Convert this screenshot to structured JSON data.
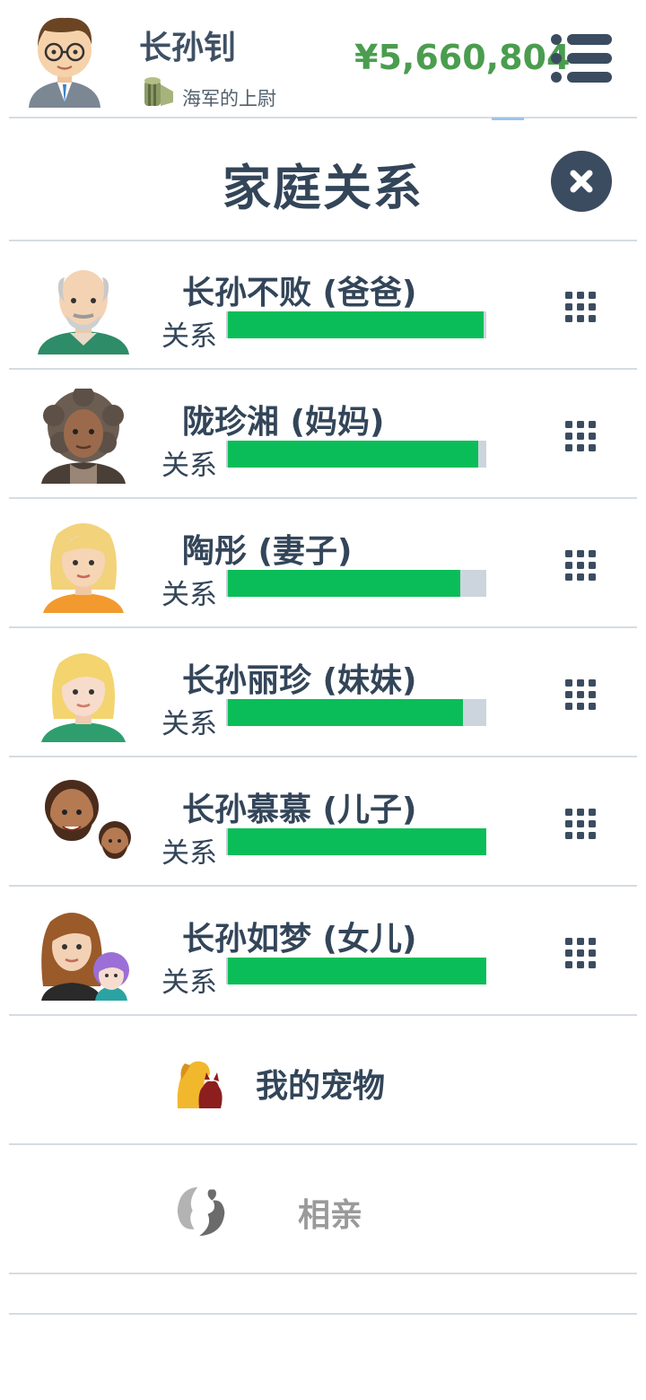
{
  "player": {
    "name": "长孙钊",
    "rank": "海军的上尉",
    "money": "¥5,660,804",
    "avatar_icon": "man-glasses-avatar",
    "rank_icon": "rank-insignia-icon"
  },
  "panel": {
    "title": "家庭关系",
    "close_icon": "close-icon"
  },
  "relationship_label": "关系",
  "family": [
    {
      "name": "长孙不败 (爸爸)",
      "relationship": 0.99,
      "avatar": "old-man-avatar"
    },
    {
      "name": "陇珍湘 (妈妈)",
      "relationship": 0.97,
      "avatar": "curly-hair-woman-avatar"
    },
    {
      "name": "陶彤 (妻子)",
      "relationship": 0.9,
      "avatar": "blonde-woman-avatar"
    },
    {
      "name": "长孙丽珍 (妹妹)",
      "relationship": 0.91,
      "avatar": "blonde-girl-avatar"
    },
    {
      "name": "长孙慕慕 (儿子)",
      "relationship": 1.0,
      "avatar": "bearded-man-with-son-avatar"
    },
    {
      "name": "长孙如梦 (女儿)",
      "relationship": 1.0,
      "avatar": "woman-with-daughter-avatar"
    }
  ],
  "links": {
    "pets": {
      "label": "我的宠物",
      "icon": "pets-icon",
      "color": "#334559"
    },
    "dating": {
      "label": "相亲",
      "icon": "couple-icon",
      "color": "#9a9a9a"
    }
  },
  "colors": {
    "bar_fill": "#0bbd58",
    "bar_bg": "#ccd5de",
    "money": "#4a9d4e",
    "text": "#334559"
  }
}
